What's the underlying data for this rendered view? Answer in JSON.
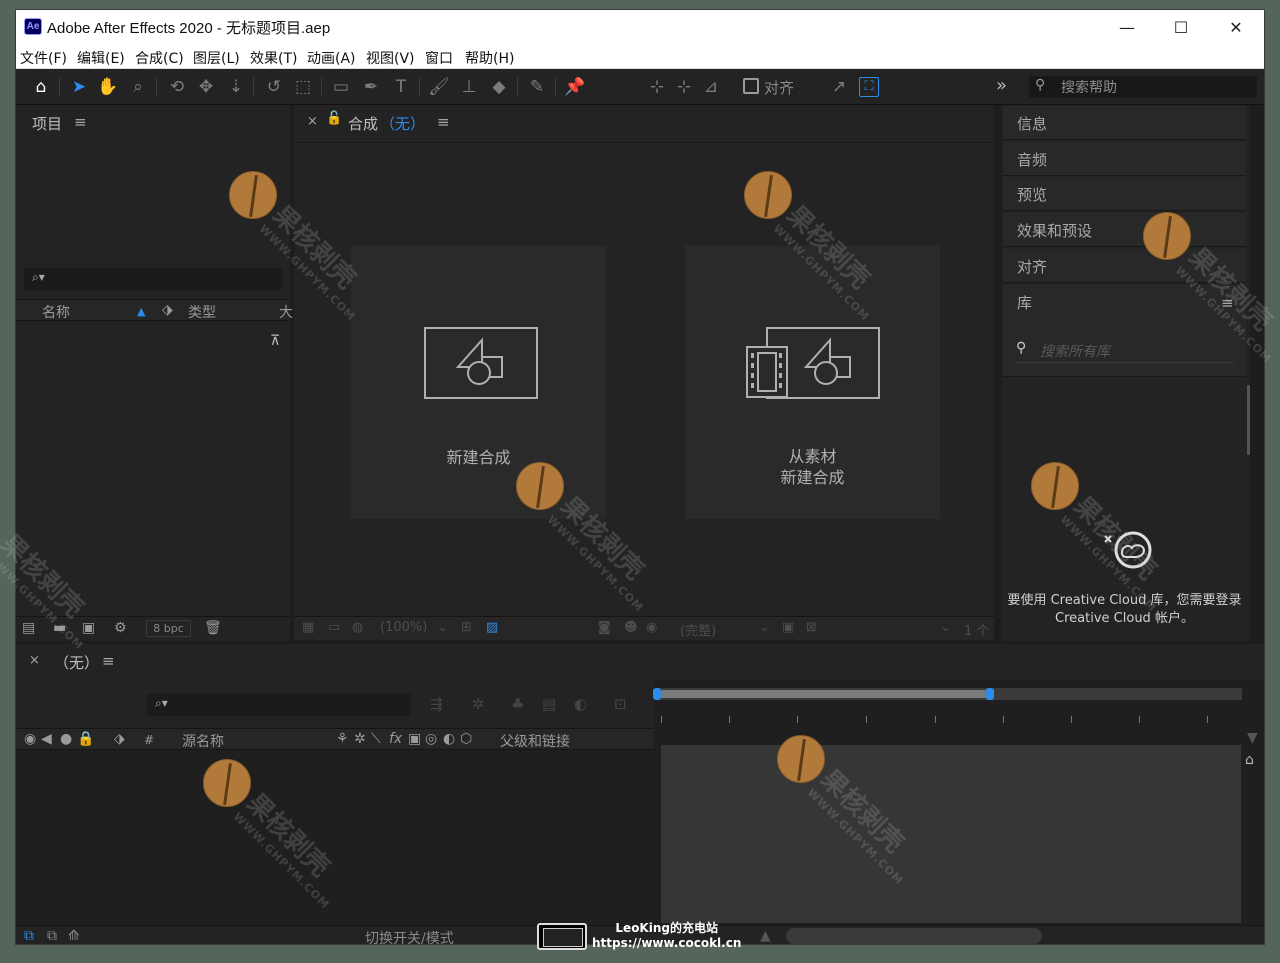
{
  "titlebar": {
    "logo": "Ae",
    "title": "Adobe After Effects 2020 - 无标题项目.aep",
    "minimize": "—",
    "maximize": "☐",
    "close": "✕"
  },
  "menu": [
    "文件(F)",
    "编辑(E)",
    "合成(C)",
    "图层(L)",
    "效果(T)",
    "动画(A)",
    "视图(V)",
    "窗口",
    "帮助(H)"
  ],
  "toolbar": {
    "align_label": "对齐",
    "more": "»",
    "help_placeholder": "搜索帮助"
  },
  "project_panel": {
    "title": "项目",
    "menu_icon": "≡",
    "search_icon": "⌕▾",
    "columns": {
      "name": "名称",
      "type": "类型",
      "extra": "大"
    },
    "bpc": "8 bpc"
  },
  "comp_panel": {
    "close": "×",
    "lock": "🔓",
    "title": "合成",
    "subtitle": "（无）",
    "menu_icon": "≡",
    "card_new_comp": "新建合成",
    "card_from_footage_1": "从素材",
    "card_from_footage_2": "新建合成",
    "zoom": "(100%)",
    "resolution": "(完整)",
    "views": "1 个"
  },
  "right_panel": {
    "items": [
      "信息",
      "音频",
      "预览",
      "效果和预设",
      "对齐",
      "库"
    ],
    "library_menu": "≡",
    "library_search_placeholder": "搜索所有库",
    "cc_line1": "要使用 Creative Cloud 库，您需要登录",
    "cc_line2": "Creative Cloud 帐户。"
  },
  "timeline": {
    "close": "×",
    "title": "（无）",
    "menu_icon": "≡",
    "search_icon": "⌕▾",
    "columns": {
      "hash": "#",
      "source_name": "源名称",
      "fx": "fx",
      "parent": "父级和链接"
    },
    "bottom_label": "切换开关/模式"
  },
  "watermark": {
    "cn": "果核剥壳",
    "url": "WWW.GHPYM.COM"
  },
  "badge": {
    "line1": "LeoKing的充电站",
    "line2": "https://www.cocokl.cn"
  }
}
